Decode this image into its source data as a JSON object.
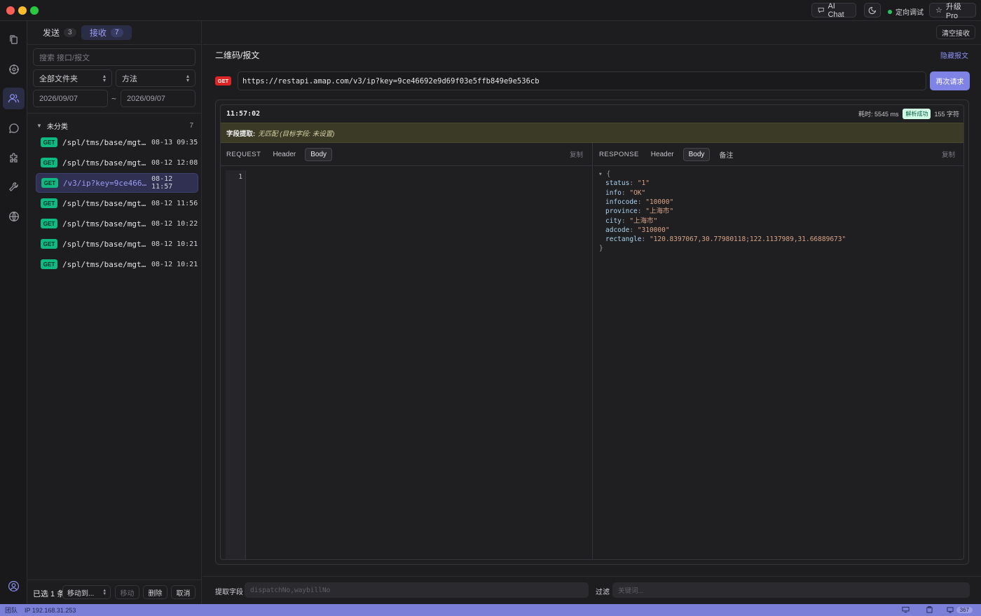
{
  "titlebar": {
    "ai_chat": "AI Chat",
    "debug_label": "定向调试",
    "upgrade": "升级 Pro"
  },
  "left": {
    "tabs": [
      {
        "label": "发送",
        "count": "3"
      },
      {
        "label": "接收",
        "count": "7"
      }
    ],
    "search_placeholder": "搜索 接口/报文",
    "folder_select": "全部文件夹",
    "method_select": "方法",
    "date_from": "2026/09/07",
    "date_sep": "~",
    "date_to": "2026/09/07",
    "group": {
      "name": "未分类",
      "count": "7"
    },
    "rows": [
      {
        "method": "GET",
        "path": "/spl/tms/base/mgt/me...",
        "time": "08-13 09:35"
      },
      {
        "method": "GET",
        "path": "/spl/tms/base/mgt/me...",
        "time": "08-12 12:08"
      },
      {
        "method": "GET",
        "path": "/v3/ip?key=9ce46692e...",
        "time": "08-12 11:57"
      },
      {
        "method": "GET",
        "path": "/spl/tms/base/mgt/me...",
        "time": "08-12 11:56"
      },
      {
        "method": "GET",
        "path": "/spl/tms/base/mgt/me...",
        "time": "08-12 10:22"
      },
      {
        "method": "GET",
        "path": "/spl/tms/base/mgt/me...",
        "time": "08-12 10:21"
      },
      {
        "method": "GET",
        "path": "/spl/tms/base/mgt/me...",
        "time": "08-12 10:21"
      }
    ],
    "footer": {
      "selected": "已选 1 条",
      "move_to": "移动到...",
      "move": "移动",
      "delete": "删除",
      "cancel": "取消"
    }
  },
  "main": {
    "clear_button": "清空接收",
    "title": "二维码/报文",
    "hide_link": "隐藏报文",
    "method": "GET",
    "url": "https://restapi.amap.com/v3/ip?key=9ce46692e9d69f03e5ffb849e9e536cb",
    "resend": "再次请求",
    "time": "11:57:02",
    "elapsed": "耗时: 5545 ms",
    "parse_badge": "解析成功",
    "chars": "155 字符",
    "extract_label": "字段提取:",
    "extract_value": "无匹配 (目标字段: 未设置)",
    "request": {
      "label": "REQUEST",
      "tabs": [
        "Header",
        "Body"
      ],
      "copy": "复制",
      "line": "1"
    },
    "response": {
      "label": "RESPONSE",
      "tabs": [
        "Header",
        "Body",
        "备注"
      ],
      "copy": "复制",
      "json": [
        {
          "key": "status",
          "value": "\"1\""
        },
        {
          "key": "info",
          "value": "\"OK\""
        },
        {
          "key": "infocode",
          "value": "\"10000\""
        },
        {
          "key": "province",
          "value": "\"上海市\""
        },
        {
          "key": "city",
          "value": "\"上海市\""
        },
        {
          "key": "adcode",
          "value": "\"310000\""
        },
        {
          "key": "rectangle",
          "value": "\"120.8397067,30.77980118;122.1137989,31.66889673\""
        }
      ]
    },
    "bottom": {
      "extract_label": "提取字段",
      "extract_placeholder": "dispatchNo,waybillNo",
      "filter_label": "过滤",
      "filter_placeholder": "关键词..."
    }
  },
  "status": {
    "team": "团队",
    "ip": "IP 192.168.31.253",
    "badge": "367"
  },
  "colors": {
    "accent": "#7b7fd8",
    "get": "#10b981",
    "danger": "#dc2626"
  }
}
